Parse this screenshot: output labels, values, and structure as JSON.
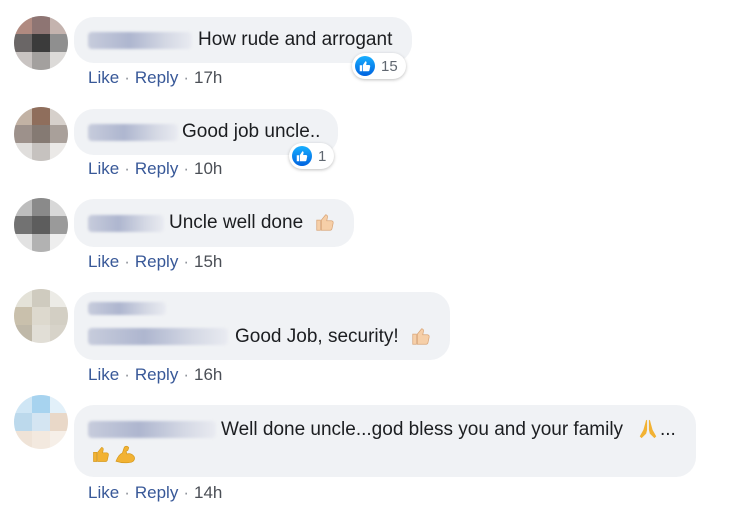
{
  "comments": [
    {
      "text": "How rude and arrogant",
      "actions": {
        "like": "Like",
        "reply": "Reply",
        "time": "17h"
      },
      "reactions": {
        "icon": "like-icon",
        "count": "15"
      }
    },
    {
      "text": "Good job uncle..",
      "actions": {
        "like": "Like",
        "reply": "Reply",
        "time": "10h"
      },
      "reactions": {
        "icon": "like-icon",
        "count": "1"
      }
    },
    {
      "text": "Uncle well done",
      "emoji": "thumbs-up-icon",
      "actions": {
        "like": "Like",
        "reply": "Reply",
        "time": "15h"
      }
    },
    {
      "text": "Good Job, security!",
      "emoji": "thumbs-up-icon",
      "actions": {
        "like": "Like",
        "reply": "Reply",
        "time": "16h"
      }
    },
    {
      "text": "Well done uncle...god bless you and your family",
      "text_suffix": "...",
      "emoji": [
        "praying-hands-icon",
        "thumbs-up-icon",
        "flexed-biceps-icon"
      ],
      "actions": {
        "like": "Like",
        "reply": "Reply",
        "time": "14h"
      }
    }
  ],
  "separator": "·",
  "colors": {
    "bubble_bg": "#f0f2f5",
    "meta_text": "#606770",
    "like_blue": "#1877f2",
    "skin_tone": "#f6cfa8",
    "praying_hands": "#f2b233"
  }
}
